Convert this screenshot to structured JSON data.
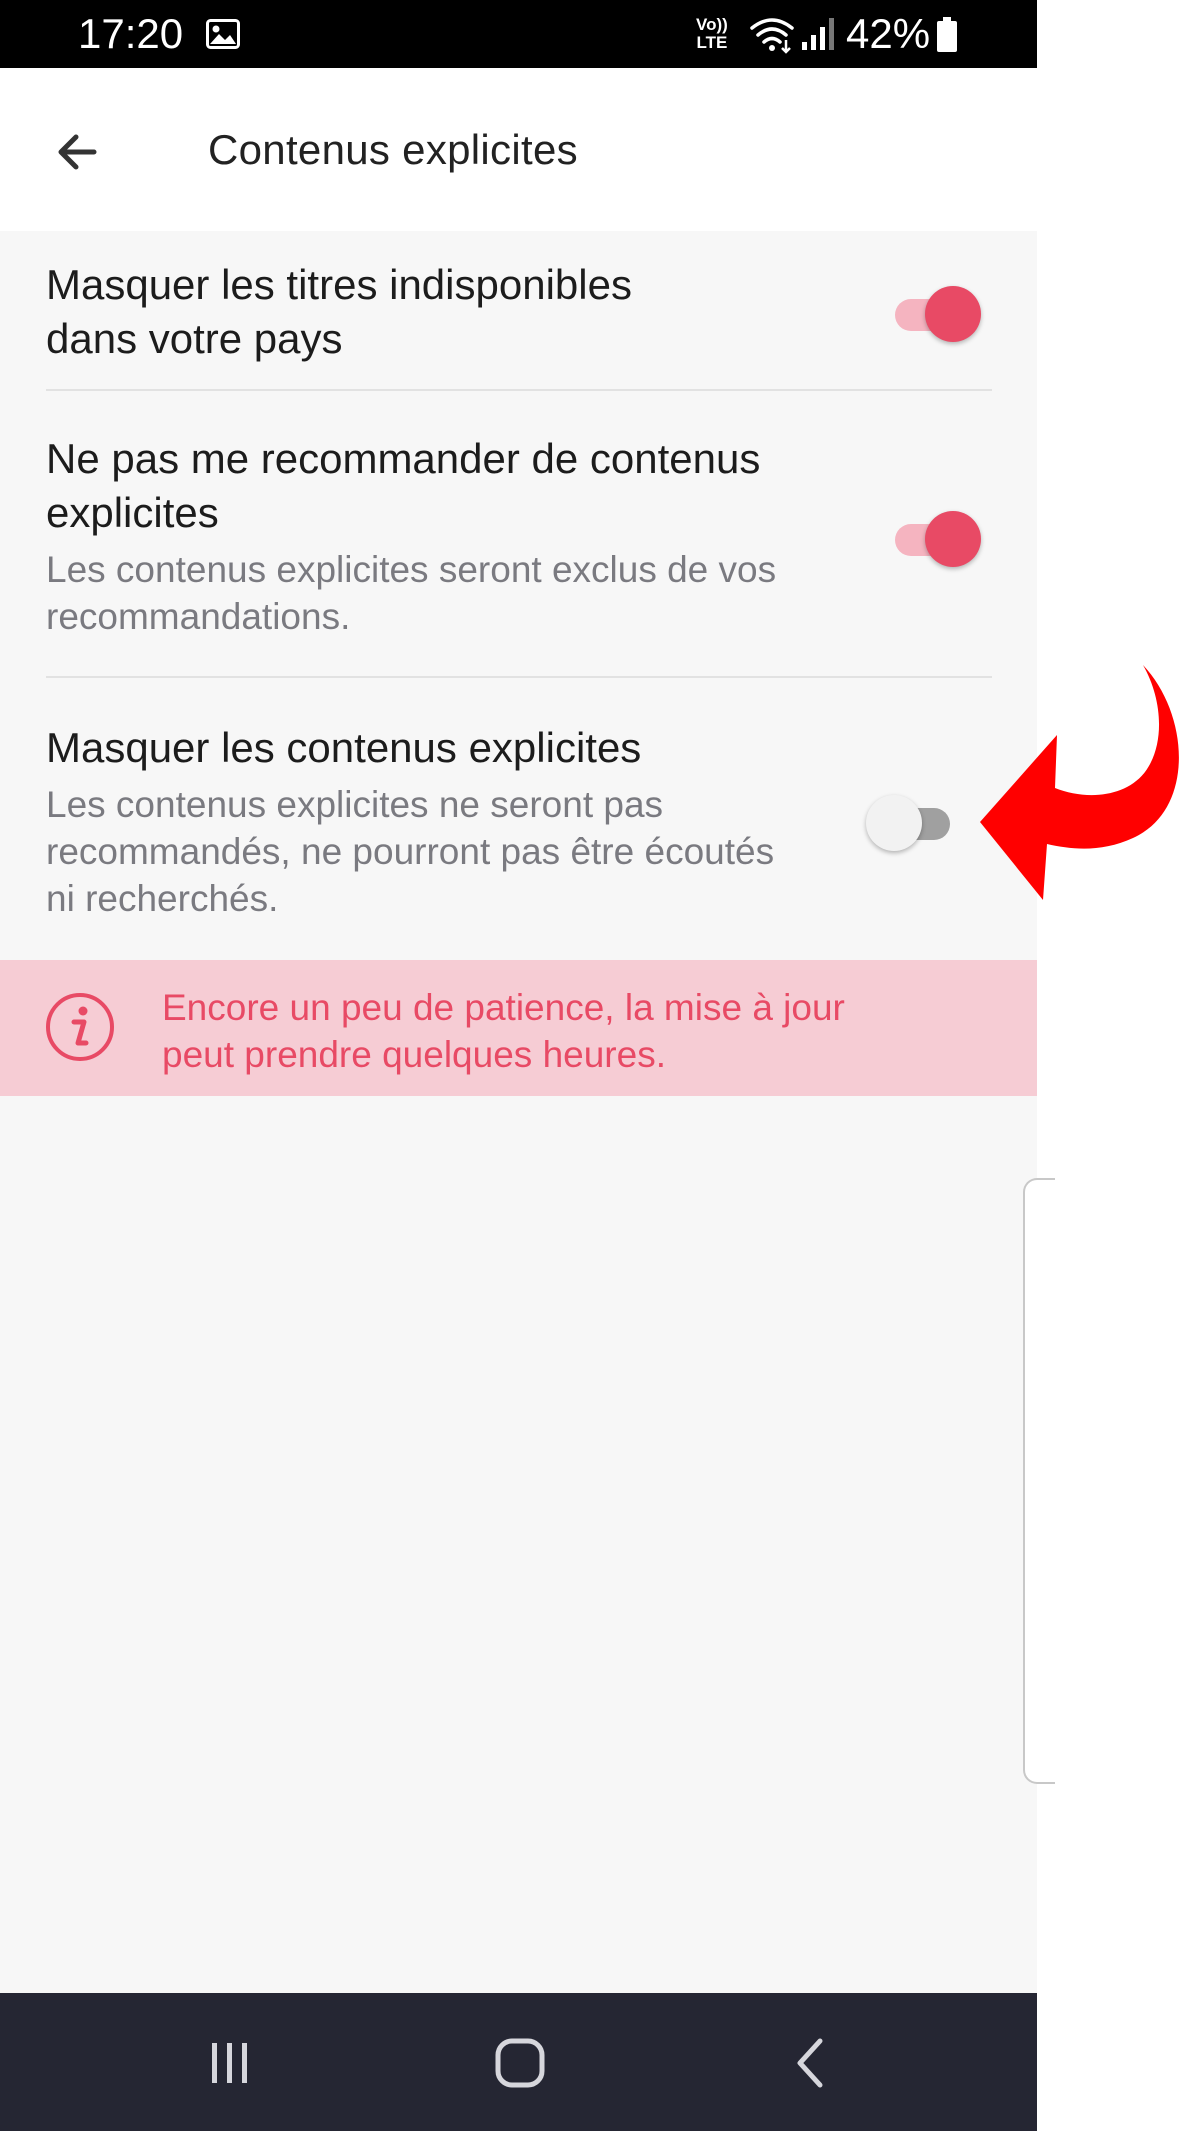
{
  "status_bar": {
    "time": "17:20",
    "volte_line1": "Vo))",
    "volte_line2": "LTE",
    "battery": "42%",
    "icons": [
      "gallery-icon",
      "wifi-icon",
      "signal-icon",
      "battery-icon"
    ]
  },
  "header": {
    "title": "Contenus explicites",
    "back_icon": "arrow-left-icon"
  },
  "settings": [
    {
      "title_lines": [
        "Masquer les titres indisponibles",
        "dans votre pays"
      ],
      "description_lines": [],
      "enabled": true
    },
    {
      "title_lines": [
        "Ne pas me recommander de contenus",
        "explicites"
      ],
      "description_lines": [
        "Les contenus explicites seront exclus de vos",
        "recommandations."
      ],
      "enabled": true
    },
    {
      "title_lines": [
        "Masquer les contenus explicites"
      ],
      "description_lines": [
        "Les contenus explicites ne seront pas",
        "recommandés, ne pourront pas être écoutés",
        "ni recherchés."
      ],
      "enabled": false
    }
  ],
  "info_banner": {
    "icon": "info-icon",
    "lines": [
      "Encore un peu de patience, la mise à jour",
      "peut prendre quelques heures."
    ]
  },
  "nav_bar": {
    "buttons": [
      "recent-apps-icon",
      "home-icon",
      "back-icon"
    ]
  },
  "colors": {
    "accent": "#e84a65",
    "accent_track": "#f5b4c0",
    "banner_bg": "#f6ccd4",
    "navbar_bg": "#252633",
    "annotation_arrow": "#ff0000"
  }
}
